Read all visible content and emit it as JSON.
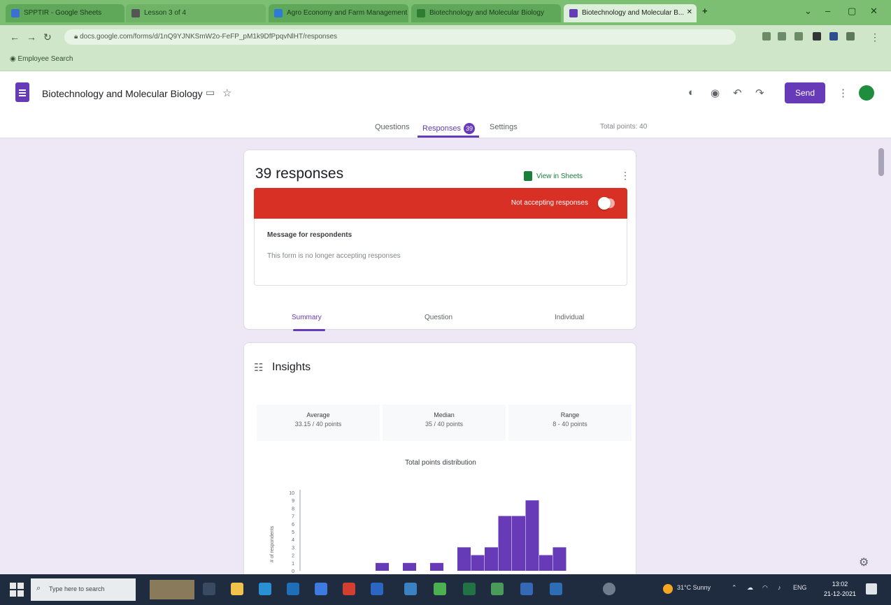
{
  "browser": {
    "tabs": [
      {
        "label": "SPPTIR - Google Sheets"
      },
      {
        "label": "Lesson 3 of 4"
      },
      {
        "label": "Agro Economy and Farm Management"
      },
      {
        "label": "Biotechnology and Molecular Biology"
      },
      {
        "label": "Biotechnology and Molecular B..."
      }
    ],
    "new_tab_label": "+",
    "url": "docs.google.com/forms/d/1nQ9YJNKSmW2o-FeFP_pM1k9DfPpqvNlHT/responses",
    "bookmark": "Employee Search"
  },
  "form": {
    "title": "Biotechnology and Molecular Biology",
    "send_label": "Send",
    "tabs": {
      "questions": "Questions",
      "responses": "Responses",
      "responses_count": "39",
      "settings": "Settings"
    },
    "total_points": "Total points: 40"
  },
  "responses": {
    "count_label": "39 responses",
    "sheets_link": "View in Sheets",
    "accepting_label": "Not accepting responses",
    "message_label": "Message for respondents",
    "message_text": "This form is no longer accepting responses",
    "view_tabs": [
      "Summary",
      "Question",
      "Individual"
    ]
  },
  "insights": {
    "title": "Insights",
    "stats": [
      {
        "label": "Average",
        "value": "33.15 / 40 points"
      },
      {
        "label": "Median",
        "value": "35 / 40 points"
      },
      {
        "label": "Range",
        "value": "8 - 40 points"
      }
    ]
  },
  "chart_data": {
    "type": "bar",
    "title": "Total points distribution",
    "ylabel": "# of respondents",
    "y_ticks": [
      "0",
      "1",
      "2",
      "3",
      "4",
      "5",
      "6",
      "7",
      "8",
      "9",
      "10"
    ],
    "ylim": [
      0,
      10
    ],
    "values": [
      1,
      0,
      1,
      0,
      1,
      0,
      3,
      2,
      3,
      7,
      7,
      9,
      2,
      3
    ],
    "color": "#673ab7"
  },
  "taskbar": {
    "search_placeholder": "Type here to search",
    "weather": "31°C Sunny",
    "time": "13:02",
    "date": "21-12-2021"
  }
}
